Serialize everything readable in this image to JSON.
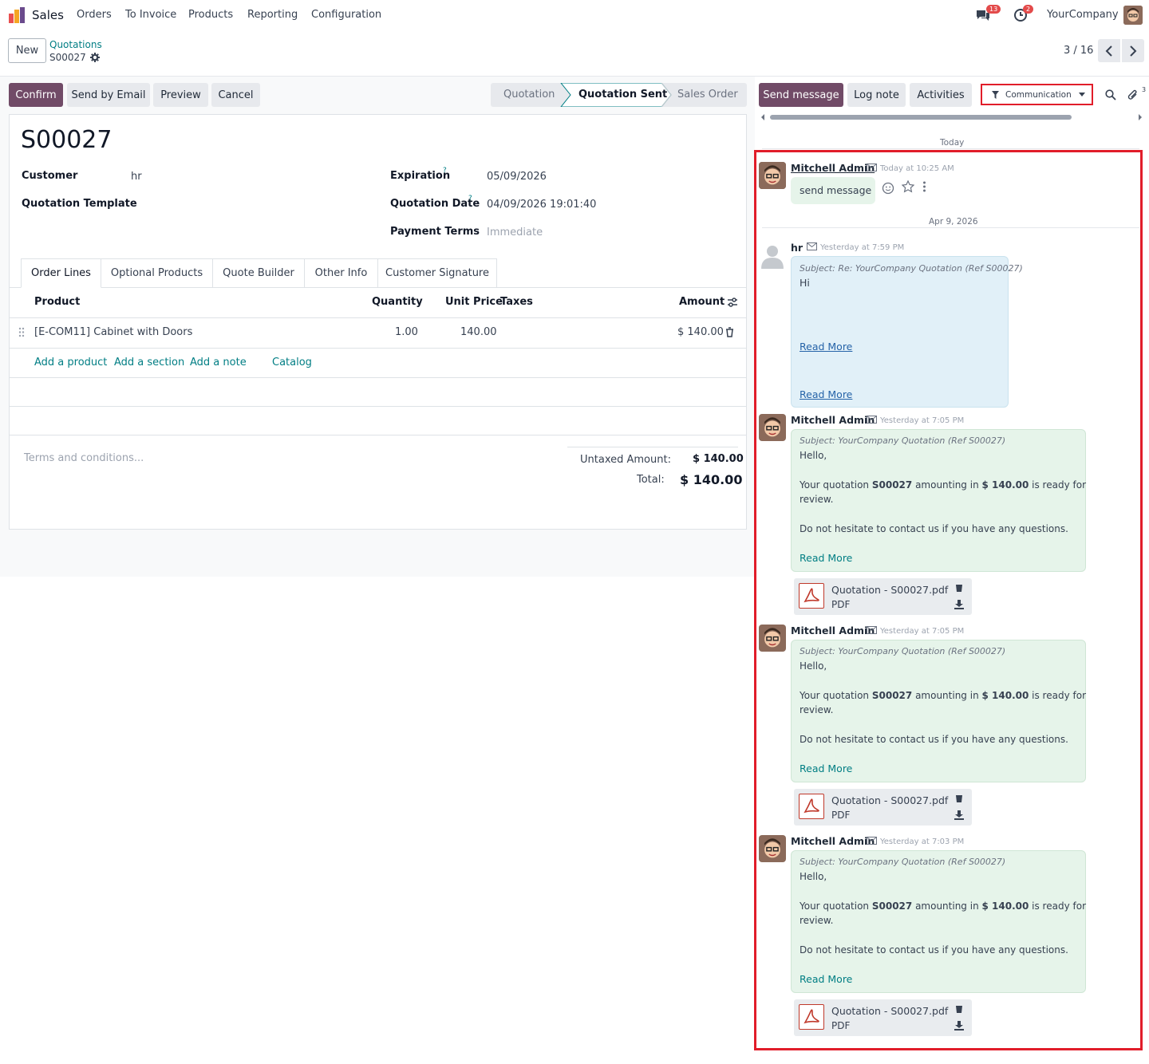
{
  "nav": {
    "app_name": "Sales",
    "menu": [
      "Orders",
      "To Invoice",
      "Products",
      "Reporting",
      "Configuration"
    ],
    "chat_count": "13",
    "activity_count": "2",
    "company": "YourCompany"
  },
  "control": {
    "new_label": "New",
    "breadcrumb_parent": "Quotations",
    "record_name": "S00027",
    "pager": "3 / 16"
  },
  "actions": {
    "confirm": "Confirm",
    "send_email": "Send by Email",
    "preview": "Preview",
    "cancel": "Cancel"
  },
  "status": {
    "steps": [
      "Quotation",
      "Quotation Sent",
      "Sales Order"
    ],
    "active": "Quotation Sent"
  },
  "form": {
    "title": "S00027",
    "customer_label": "Customer",
    "customer_value": "hr",
    "template_label": "Quotation Template",
    "expiration_label": "Expiration",
    "expiration_value": "05/09/2026",
    "qdate_label": "Quotation Date",
    "qdate_value": "04/09/2026 19:01:40",
    "terms_label": "Payment Terms",
    "terms_value": "Immediate",
    "help_mark": "?"
  },
  "tabs": [
    "Order Lines",
    "Optional Products",
    "Quote Builder",
    "Other Info",
    "Customer Signature"
  ],
  "lines": {
    "headers": {
      "product": "Product",
      "quantity": "Quantity",
      "unit_price": "Unit Price",
      "taxes": "Taxes",
      "amount": "Amount"
    },
    "rows": [
      {
        "product": "[E-COM11] Cabinet with Doors",
        "quantity": "1.00",
        "unit_price": "140.00",
        "taxes": "",
        "amount": "$ 140.00"
      }
    ],
    "add_product": "Add a product",
    "add_section": "Add a section",
    "add_note": "Add a note",
    "catalog": "Catalog"
  },
  "totals": {
    "terms_placeholder": "Terms and conditions...",
    "untaxed_label": "Untaxed Amount:",
    "untaxed_value": "$ 140.00",
    "total_label": "Total:",
    "total_value": "$ 140.00"
  },
  "chatter": {
    "send_message": "Send message",
    "log_note": "Log note",
    "activities": "Activities",
    "filter": "Communication",
    "attachments_count": "3",
    "today": "Today",
    "date_sep": "Apr 9, 2026",
    "messages": [
      {
        "author": "Mitchell Admin",
        "time": "Today at 10:25 AM",
        "body": "send message"
      },
      {
        "author": "hr",
        "time": "Yesterday at 7:59 PM",
        "subject": "Subject: Re: YourCompany Quotation (Ref S00027)",
        "body": "Hi",
        "read_more": "Read More",
        "read_more2": "Read More"
      },
      {
        "author": "Mitchell Admin",
        "time": "Yesterday at 7:05 PM",
        "subject": "Subject: YourCompany Quotation (Ref S00027)",
        "hello": "Hello,",
        "line1_a": "Your quotation ",
        "line1_b": "S00027",
        "line1_c": " amounting in ",
        "line1_d": "$ 140.00",
        "line1_e": " is ready for",
        "line2": "review.",
        "line3": "Do not hesitate to contact us if you have any questions.",
        "read_more": "Read More",
        "attachment": "Quotation - S00027.pdf",
        "attachment_type": "PDF"
      },
      {
        "author": "Mitchell Admin",
        "time": "Yesterday at 7:05 PM",
        "subject": "Subject: YourCompany Quotation (Ref S00027)",
        "hello": "Hello,",
        "line1_a": "Your quotation ",
        "line1_b": "S00027",
        "line1_c": " amounting in ",
        "line1_d": "$ 140.00",
        "line1_e": " is ready for",
        "line2": "review.",
        "line3": "Do not hesitate to contact us if you have any questions.",
        "read_more": "Read More",
        "attachment": "Quotation - S00027.pdf",
        "attachment_type": "PDF"
      },
      {
        "author": "Mitchell Admin",
        "time": "Yesterday at 7:03 PM",
        "subject": "Subject: YourCompany Quotation (Ref S00027)",
        "hello": "Hello,",
        "line1_a": "Your quotation ",
        "line1_b": "S00027",
        "line1_c": " amounting in ",
        "line1_d": "$ 140.00",
        "line1_e": " is ready for",
        "line2": "review.",
        "line3": "Do not hesitate to contact us if you have any questions.",
        "read_more": "Read More",
        "attachment": "Quotation - S00027.pdf",
        "attachment_type": "PDF"
      }
    ]
  },
  "colors": {
    "brand": "#714b67",
    "link": "#017e84",
    "highlight": "#e11d2a",
    "note_green": "#e6f4ea",
    "note_blue": "#e1f0f8"
  }
}
